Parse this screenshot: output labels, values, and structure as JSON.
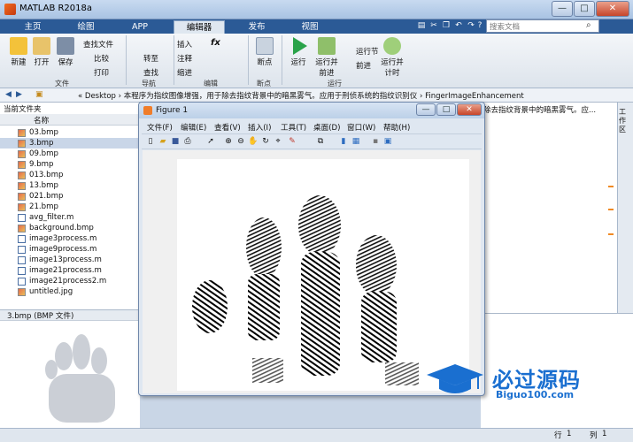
{
  "window": {
    "title": "MATLAB R2018a",
    "min": "—",
    "max": "□",
    "close": "✕"
  },
  "tabs": [
    "主页",
    "绘图",
    "APP",
    "编辑器",
    "发布",
    "视图"
  ],
  "search": {
    "placeholder": "搜索文档"
  },
  "ribbon": {
    "new": "新建",
    "open": "打开",
    "save": "保存",
    "find_files": "查找文件",
    "compare": "比较",
    "print": "打印",
    "insert": "插入",
    "comment": "注释",
    "indent": "缩进",
    "goto": "转至",
    "find": "查找",
    "fx": "fx",
    "breakpoints": "断点",
    "run": "运行",
    "run_advance": [
      "运行并",
      "前进"
    ],
    "run_section": "运行节",
    "advance": "前进",
    "run_time": [
      "运行并",
      "计时"
    ],
    "groups": {
      "file": "文件",
      "navigate": "导航",
      "edit": "编辑",
      "breakpoints": "断点",
      "run": "运行"
    }
  },
  "address": {
    "path": "« Desktop › 本程序为指纹图像增强，用于除去指纹背景中的暗黑雾气。应用于刑侦系统的指纹识别仪 › FingerImageEnhancement"
  },
  "current_folder": {
    "title": "当前文件夹",
    "col_name": "名称",
    "files": [
      {
        "name": "03.bmp",
        "type": "img"
      },
      {
        "name": "3.bmp",
        "type": "img",
        "selected": true
      },
      {
        "name": "09.bmp",
        "type": "img"
      },
      {
        "name": "9.bmp",
        "type": "img"
      },
      {
        "name": "013.bmp",
        "type": "img"
      },
      {
        "name": "13.bmp",
        "type": "img"
      },
      {
        "name": "021.bmp",
        "type": "img"
      },
      {
        "name": "21.bmp",
        "type": "img"
      },
      {
        "name": "avg_filter.m",
        "type": "m"
      },
      {
        "name": "background.bmp",
        "type": "img"
      },
      {
        "name": "image3process.m",
        "type": "m"
      },
      {
        "name": "image9process.m",
        "type": "m"
      },
      {
        "name": "image13process.m",
        "type": "m"
      },
      {
        "name": "image21process.m",
        "type": "m"
      },
      {
        "name": "image21process2.m",
        "type": "m"
      },
      {
        "name": "untitled.jpg",
        "type": "img"
      }
    ]
  },
  "preview": {
    "title": "3.bmp  (BMP 文件)"
  },
  "right_panel": {
    "text": "除去指纹背景中的暗黑雾气。应...",
    "side_label": "工作区"
  },
  "figure": {
    "title": "Figure 1",
    "menu": [
      "文件(F)",
      "编辑(E)",
      "查看(V)",
      "插入(I)",
      "工具(T)",
      "桌面(D)",
      "窗口(W)",
      "帮助(H)"
    ]
  },
  "status": {
    "row_label": "行",
    "row": "1",
    "col_label": "列",
    "col": "1"
  },
  "watermark": {
    "main": "必过源码",
    "sub": "Biguo100.com"
  },
  "colors": {
    "accent": "#2b5a96",
    "watermark": "#1a6fd0"
  }
}
